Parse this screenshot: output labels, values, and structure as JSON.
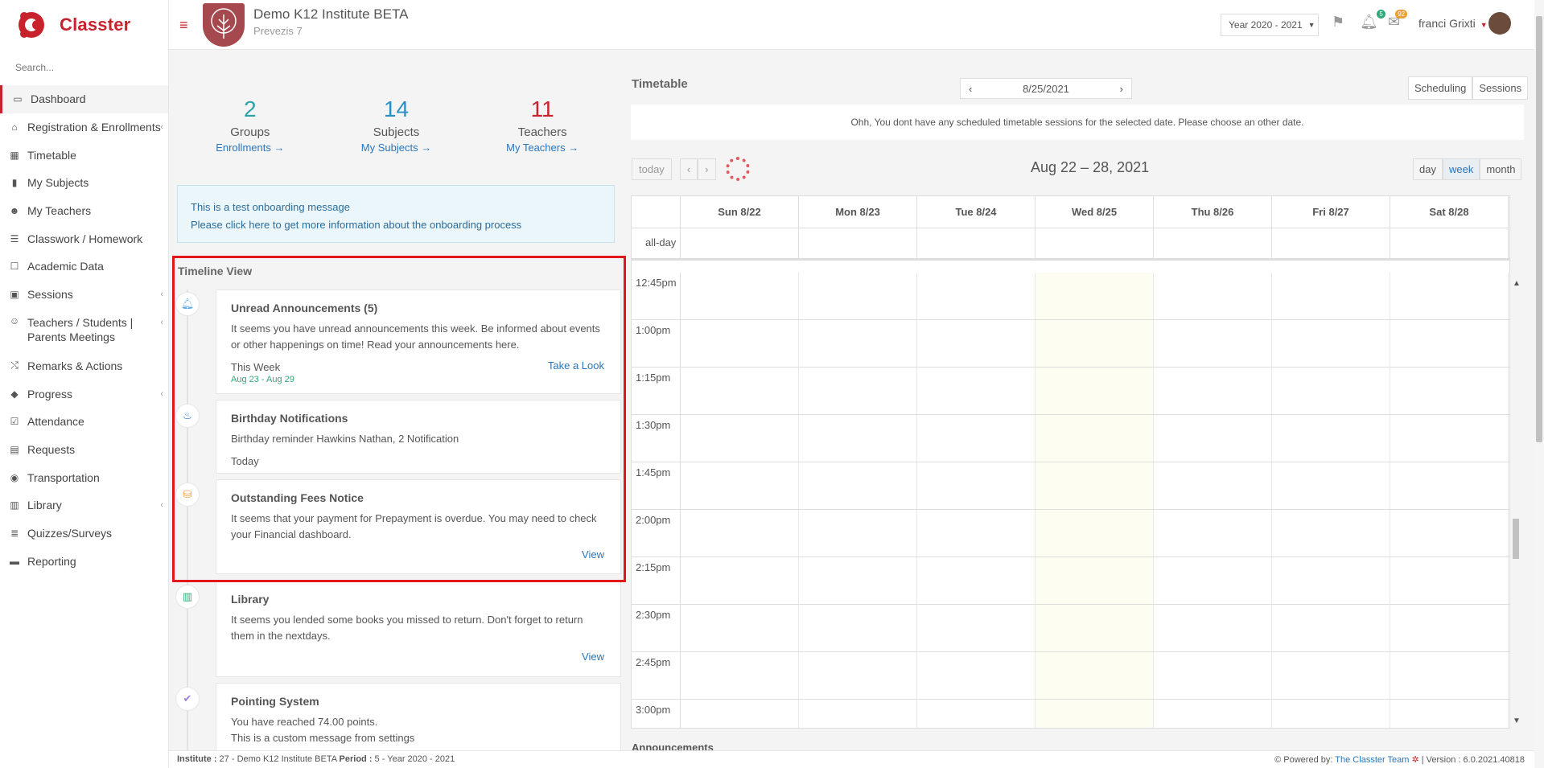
{
  "brand": {
    "name": "Classter"
  },
  "search": {
    "placeholder": "Search..."
  },
  "sidebar": {
    "items": [
      {
        "label": "Dashboard",
        "icon": "laptop-icon",
        "active": true
      },
      {
        "label": "Registration & Enrollments",
        "icon": "institution-icon",
        "chevron": true
      },
      {
        "label": "Timetable",
        "icon": "calendar-icon"
      },
      {
        "label": "My Subjects",
        "icon": "book-icon"
      },
      {
        "label": "My Teachers",
        "icon": "users-icon"
      },
      {
        "label": "Classwork / Homework",
        "icon": "list-icon"
      },
      {
        "label": "Academic Data",
        "icon": "user-card-icon"
      },
      {
        "label": "Sessions",
        "icon": "screen-icon",
        "chevron": true
      },
      {
        "label": "Teachers / Students | Parents Meetings",
        "icon": "meeting-icon",
        "chevron": true
      },
      {
        "label": "Remarks & Actions",
        "icon": "shuffle-icon"
      },
      {
        "label": "Progress",
        "icon": "graduation-cap-icon",
        "chevron": true
      },
      {
        "label": "Attendance",
        "icon": "user-check-icon"
      },
      {
        "label": "Requests",
        "icon": "document-icon"
      },
      {
        "label": "Transportation",
        "icon": "bus-icon"
      },
      {
        "label": "Library",
        "icon": "library-icon",
        "chevron": true
      },
      {
        "label": "Quizzes/Surveys",
        "icon": "checklist-icon"
      },
      {
        "label": "Reporting",
        "icon": "printer-icon"
      }
    ]
  },
  "header": {
    "institute_title": "Demo K12 Institute BETA",
    "institute_subtitle": "Prevezis 7",
    "year": "Year 2020 - 2021",
    "notifications_count": "5",
    "messages_count": "92",
    "user_name": "franci Grixti"
  },
  "stats": [
    {
      "number": "2",
      "label": "Groups",
      "link": "Enrollments  →",
      "color": "#2aa3a8"
    },
    {
      "number": "14",
      "label": "Subjects",
      "link": "My Subjects  →",
      "color": "#2a8fc6"
    },
    {
      "number": "11",
      "label": "Teachers",
      "link": "My Teachers  →",
      "color": "#c8232c"
    }
  ],
  "onboarding": {
    "line1": "This is a test onboarding message",
    "line2": "Please click here to get more information about the onboarding process"
  },
  "timeline": {
    "title": "Timeline View",
    "items": [
      {
        "title": "Unread Announcements (5)",
        "body": "It seems you have unread announcements this week. Be informed about events or other happenings on time! Read your announcements here.",
        "when": "This Week",
        "range": "Aug 23 - Aug 29",
        "action": "Take a Look",
        "icon": "bell-icon",
        "icon_color": "#5aa9e6"
      },
      {
        "title": "Birthday Notifications",
        "body": "Birthday reminder Hawkins Nathan, 2 Notification",
        "when": "Today",
        "icon": "birthday-cake-icon",
        "icon_color": "#2a75b8"
      },
      {
        "title": "Outstanding Fees Notice",
        "body": "It seems that your payment for Prepayment is overdue. You may need to check your Financial dashboard.",
        "action": "View",
        "icon": "coins-icon",
        "icon_color": "#f0a030"
      },
      {
        "title": "Library",
        "body": "It seems you lended some books you missed to return. Don't forget to return them in the nextdays.",
        "action": "View",
        "icon": "library-icon",
        "icon_color": "#2fa87a"
      },
      {
        "title": "Pointing System",
        "body": "You have reached 74.00 points.",
        "body2": "This is a custom message from settings",
        "icon": "check-circle-icon",
        "icon_color": "#9b7fd4"
      }
    ]
  },
  "timetable": {
    "title": "Timetable",
    "date": "8/25/2021",
    "scheduling_label": "Scheduling",
    "sessions_label": "Sessions",
    "message": "Ohh, You dont have any scheduled timetable sessions for the selected date. Please choose an other date."
  },
  "calendar": {
    "today_label": "today",
    "range": "Aug 22 – 28, 2021",
    "views": [
      "day",
      "week",
      "month"
    ],
    "active_view": "week",
    "days": [
      "Sun 8/22",
      "Mon 8/23",
      "Tue 8/24",
      "Wed 8/25",
      "Thu 8/26",
      "Fri 8/27",
      "Sat 8/28"
    ],
    "allday_label": "all-day",
    "times": [
      "12:45pm",
      "1:00pm",
      "1:15pm",
      "1:30pm",
      "1:45pm",
      "2:00pm",
      "2:15pm",
      "2:30pm",
      "2:45pm",
      "3:00pm"
    ]
  },
  "announcements": {
    "title": "Announcements"
  },
  "footer": {
    "institute_label": "Institute :",
    "institute_value": " 27 - Demo K12 Institute BETA ",
    "period_label": "Period :",
    "period_value": " 5 - Year 2020 - 2021",
    "powered_by": "Powered by:",
    "team": "The Classter Team",
    "version": "| Version : 6.0.2021.40818"
  }
}
